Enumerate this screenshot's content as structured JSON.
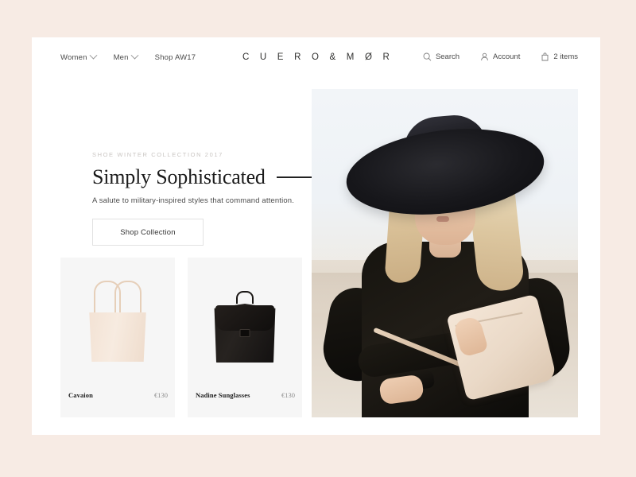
{
  "site": {
    "brand": "C U E R O & M Ø R"
  },
  "header": {
    "nav": [
      {
        "label": "Women",
        "has_dropdown": true
      },
      {
        "label": "Men",
        "has_dropdown": true
      },
      {
        "label": "Shop AW17",
        "has_dropdown": false
      }
    ],
    "utilities": [
      {
        "label": "Search",
        "icon": "search-icon"
      },
      {
        "label": "Account",
        "icon": "account-icon"
      },
      {
        "label": "2 items",
        "icon": "shopping-bag-icon"
      }
    ]
  },
  "hero": {
    "eyebrow": "SHOE WINTER COLLECTION 2017",
    "headline": "Simply Sophisticated",
    "subtitle": "A salute to military-inspired styles that command attention.",
    "cta_label": "Shop Collection",
    "photo_alt": "Model in wide-brim black hat holding cream clutch bag"
  },
  "products": [
    {
      "name": "Cavaion",
      "price": "€130",
      "image": "cream-tote-bag"
    },
    {
      "name": "Nadine Sunglasses",
      "price": "€130",
      "image": "black-backpack"
    }
  ],
  "colors": {
    "page_background": "#f7ebe4",
    "card_background": "#ffffff",
    "product_tile": "#f6f6f6",
    "text_primary": "#1b1b1b",
    "text_muted": "#8c8c8c",
    "eyebrow": "#cac6c3"
  }
}
